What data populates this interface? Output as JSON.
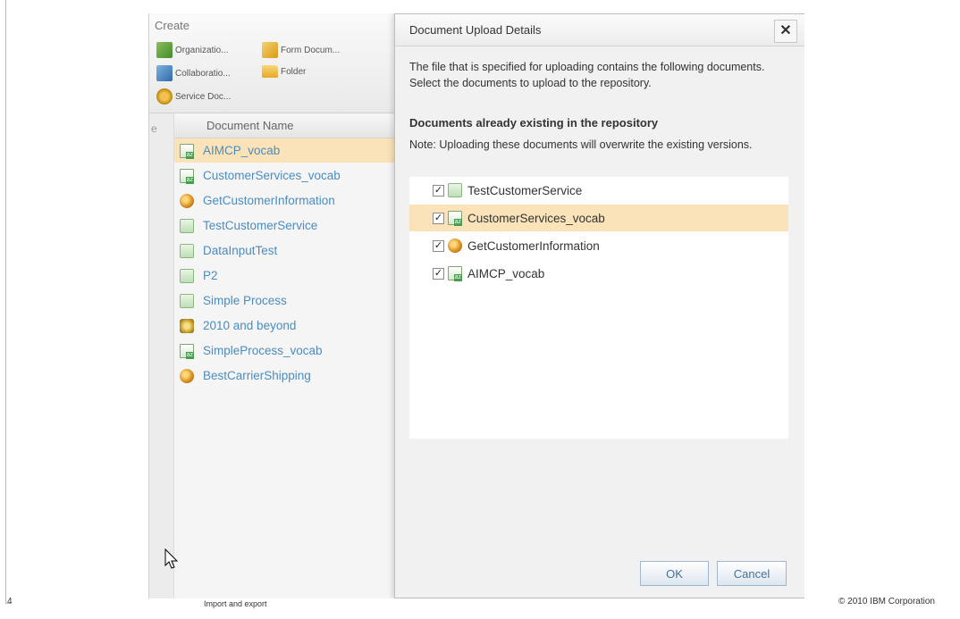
{
  "slide": {
    "page_number": "4",
    "footer_text": "Import and export",
    "copyright": "© 2010 IBM Corporation"
  },
  "create_panel": {
    "title": "Create",
    "items": [
      {
        "label": "Organizatio...",
        "icon": "organization-icon"
      },
      {
        "label": "Form Docum...",
        "icon": "form-document-icon"
      },
      {
        "label": "Collaboratio...",
        "icon": "collaboration-icon"
      },
      {
        "label": "Folder",
        "icon": "folder-icon"
      },
      {
        "label": "Service Doc...",
        "icon": "service-document-icon"
      }
    ]
  },
  "document_list": {
    "gutter_label": "e",
    "header": "Document Name",
    "rows": [
      {
        "name": "AIMCP_vocab",
        "icon": "vocabulary-icon",
        "selected": true
      },
      {
        "name": "CustomerServices_vocab",
        "icon": "vocabulary-icon",
        "selected": false
      },
      {
        "name": "GetCustomerInformation",
        "icon": "rule-icon",
        "selected": false
      },
      {
        "name": "TestCustomerService",
        "icon": "process-icon",
        "selected": false
      },
      {
        "name": "DataInputTest",
        "icon": "process-icon",
        "selected": false
      },
      {
        "name": "P2",
        "icon": "process-icon",
        "selected": false
      },
      {
        "name": "Simple Process",
        "icon": "process-icon",
        "selected": false
      },
      {
        "name": "2010 and beyond",
        "icon": "decision-icon",
        "selected": false
      },
      {
        "name": "SimpleProcess_vocab",
        "icon": "vocabulary-icon",
        "selected": false
      },
      {
        "name": "BestCarrierShipping",
        "icon": "rule-icon",
        "selected": false
      }
    ]
  },
  "dialog": {
    "title": "Document Upload Details",
    "close_label": "✕",
    "intro": "The file that is specified for uploading contains the following documents. Select the documents to upload to the repository.",
    "section_heading": "Documents already existing in the repository",
    "note": "Note: Uploading these documents will overwrite the existing versions.",
    "items": [
      {
        "name": "TestCustomerService",
        "checked": true,
        "icon": "process-icon",
        "selected": false
      },
      {
        "name": "CustomerServices_vocab",
        "checked": true,
        "icon": "vocabulary-icon",
        "selected": true
      },
      {
        "name": "GetCustomerInformation",
        "checked": true,
        "icon": "rule-icon",
        "selected": false
      },
      {
        "name": "AIMCP_vocab",
        "checked": true,
        "icon": "vocabulary-icon",
        "selected": false
      }
    ],
    "ok_label": "OK",
    "cancel_label": "Cancel"
  },
  "colors": {
    "selection": "#fbe3b9",
    "link_text": "#4a8cc0",
    "title_blue": "#3a63d6"
  }
}
